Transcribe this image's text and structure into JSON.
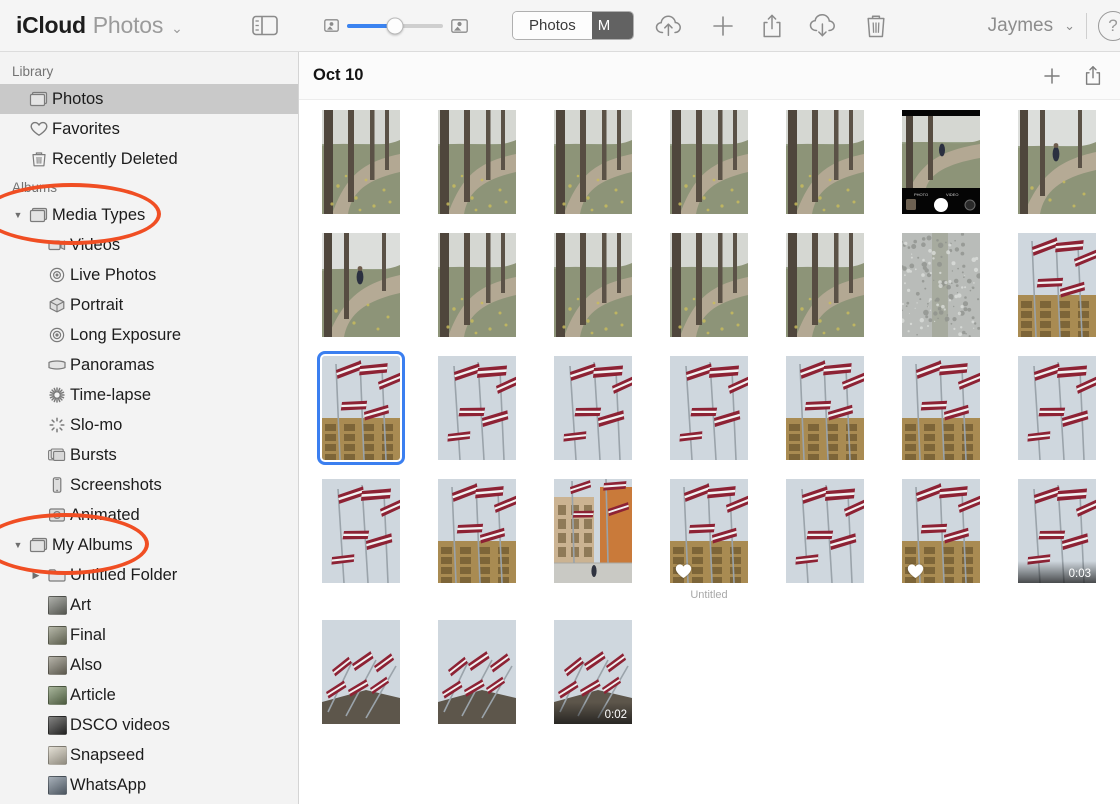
{
  "toolbar": {
    "brand_primary": "iCloud",
    "brand_app": "Photos",
    "brand_chevron": "⌄",
    "sidebar_toggle_icon": "sidebar-toggle-icon",
    "zoom_slider": {
      "min_icon": "small-thumbnail-icon",
      "max_icon": "large-thumbnail-icon",
      "value_percent": 50,
      "accent": "#3b83f0"
    },
    "segments": [
      {
        "label": "Photos",
        "selected": true
      },
      {
        "label": "M",
        "selected": false
      }
    ],
    "actions": [
      {
        "name": "upload-icon",
        "label": "Upload"
      },
      {
        "name": "add-icon",
        "label": "Add"
      },
      {
        "name": "share-icon",
        "label": "Share"
      },
      {
        "name": "download-icon",
        "label": "Download"
      },
      {
        "name": "delete-icon",
        "label": "Delete"
      }
    ],
    "user_name": "Jaymes",
    "user_chevron": "⌄",
    "help_label": "?"
  },
  "sidebar": {
    "sections": [
      {
        "title": "Library",
        "items": [
          {
            "label": "Photos",
            "icon": "photos-icon",
            "selected": true,
            "indent": 0
          },
          {
            "label": "Favorites",
            "icon": "heart-icon",
            "selected": false,
            "indent": 0
          },
          {
            "label": "Recently Deleted",
            "icon": "trash-icon",
            "selected": false,
            "indent": 0
          }
        ]
      },
      {
        "title": "Albums",
        "items": [
          {
            "label": "Media Types",
            "icon": "album-stack-icon",
            "disclosure": "open",
            "indent": 0,
            "annotated": true
          },
          {
            "label": "Videos",
            "icon": "video-icon",
            "indent": 1
          },
          {
            "label": "Live Photos",
            "icon": "live-photo-icon",
            "indent": 1
          },
          {
            "label": "Portrait",
            "icon": "portrait-cube-icon",
            "indent": 1
          },
          {
            "label": "Long Exposure",
            "icon": "long-exposure-icon",
            "indent": 1
          },
          {
            "label": "Panoramas",
            "icon": "panorama-icon",
            "indent": 1
          },
          {
            "label": "Time-lapse",
            "icon": "time-lapse-icon",
            "indent": 1
          },
          {
            "label": "Slo-mo",
            "icon": "slo-mo-icon",
            "indent": 1
          },
          {
            "label": "Bursts",
            "icon": "bursts-icon",
            "indent": 1
          },
          {
            "label": "Screenshots",
            "icon": "screenshot-icon",
            "indent": 1
          },
          {
            "label": "Animated",
            "icon": "animated-icon",
            "indent": 1
          },
          {
            "label": "My Albums",
            "icon": "album-stack-icon",
            "disclosure": "open",
            "indent": 0,
            "annotated": true
          },
          {
            "label": "Untitled Folder",
            "icon": "folder-icon",
            "disclosure": "closed",
            "indent": 1
          },
          {
            "label": "Art",
            "icon": "album-thumb",
            "thumb": "#7c7f74",
            "indent": 1
          },
          {
            "label": "Final",
            "icon": "album-thumb",
            "thumb": "#8b8f70",
            "indent": 1
          },
          {
            "label": "Also",
            "icon": "album-thumb",
            "thumb": "#8a8570",
            "indent": 1
          },
          {
            "label": "Article",
            "icon": "album-thumb",
            "thumb": "#6f8a55",
            "indent": 1
          },
          {
            "label": "DSCO videos",
            "icon": "album-thumb",
            "thumb": "#20201e",
            "indent": 1
          },
          {
            "label": "Snapseed",
            "icon": "album-thumb",
            "thumb": "#ece3cd",
            "indent": 1
          },
          {
            "label": "WhatsApp",
            "icon": "album-thumb",
            "thumb": "#6d7f92",
            "indent": 1
          }
        ]
      }
    ],
    "annotation_color": "#f04e23"
  },
  "grid": {
    "date_header": "Oct 10",
    "header_actions": [
      {
        "name": "add-to-album-icon",
        "label": "Add"
      },
      {
        "name": "share-icon",
        "label": "Share"
      }
    ],
    "rows": [
      [
        {
          "kind": "park"
        },
        {
          "kind": "park"
        },
        {
          "kind": "park"
        },
        {
          "kind": "park"
        },
        {
          "kind": "park"
        },
        {
          "kind": "camera-ui"
        },
        {
          "kind": "park-person"
        }
      ],
      [
        {
          "kind": "park-person"
        },
        {
          "kind": "park"
        },
        {
          "kind": "park"
        },
        {
          "kind": "park"
        },
        {
          "kind": "park"
        },
        {
          "kind": "gravel"
        },
        {
          "kind": "flags-building"
        }
      ],
      [
        {
          "kind": "flags-building",
          "selected": true
        },
        {
          "kind": "flags"
        },
        {
          "kind": "flags"
        },
        {
          "kind": "flags"
        },
        {
          "kind": "flags-building"
        },
        {
          "kind": "flags-building"
        },
        {
          "kind": "flags"
        }
      ],
      [
        {
          "kind": "flags"
        },
        {
          "kind": "flags-building"
        },
        {
          "kind": "flags-street"
        },
        {
          "kind": "flags-building",
          "favorite": true,
          "caption": "Untitled"
        },
        {
          "kind": "flags"
        },
        {
          "kind": "flags-building",
          "favorite": true
        },
        {
          "kind": "flags",
          "duration": "0:03"
        }
      ],
      [
        {
          "kind": "flags-roof"
        },
        {
          "kind": "flags-roof"
        },
        {
          "kind": "flags-roof",
          "duration": "0:02"
        }
      ]
    ]
  }
}
